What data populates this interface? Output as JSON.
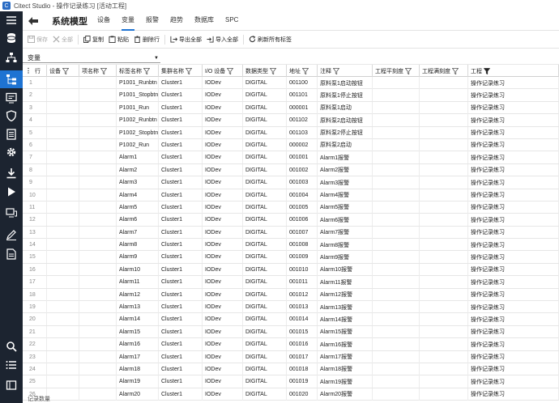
{
  "window": {
    "title": "Citect Studio - 操作记录练习 [活动工程]",
    "logo": "C"
  },
  "sidebar": {
    "items": [
      "database-icon",
      "network-icon",
      "tree-icon",
      "display-icon",
      "shield-icon",
      "document-list-icon",
      "gear-icon",
      "download-icon",
      "play-icon",
      "monitor-icon",
      "edit-icon",
      "report-icon",
      "search-icon",
      "list-icon",
      "book-icon"
    ]
  },
  "nav": {
    "module_title": "系统模型",
    "tabs": [
      "设备",
      "变量",
      "报警",
      "趋势",
      "数据库",
      "SPC"
    ],
    "selected": "变量"
  },
  "toolbar": {
    "save": "保存",
    "delete_all": "全部",
    "copy": "复制",
    "paste": "粘贴",
    "delete_row": "删除行",
    "export_all": "导出全部",
    "import_all": "导入全部",
    "refresh": "刷新所有标签"
  },
  "selector": {
    "value": "变量"
  },
  "grid": {
    "columns": [
      "行",
      "设备",
      "项名称",
      "标签名称",
      "集群名称",
      "I/O 设备",
      "数据类型",
      "地址",
      "注释",
      "工程平刻度",
      "工程满刻度",
      "工程"
    ],
    "rows": [
      [
        "1",
        "",
        "",
        "P1001_Runbtn",
        "Cluster1",
        "IODev",
        "DIGITAL",
        "001100",
        "原料泵1启动按钮",
        "",
        "",
        "操作记录练习"
      ],
      [
        "2",
        "",
        "",
        "P1001_Stopbtn",
        "Cluster1",
        "IODev",
        "DIGITAL",
        "001101",
        "原料泵1停止按钮",
        "",
        "",
        "操作记录练习"
      ],
      [
        "3",
        "",
        "",
        "P1001_Run",
        "Cluster1",
        "IODev",
        "DIGITAL",
        "000001",
        "原料泵1启动",
        "",
        "",
        "操作记录练习"
      ],
      [
        "4",
        "",
        "",
        "P1002_Runbtn",
        "Cluster1",
        "IODev",
        "DIGITAL",
        "001102",
        "原料泵2启动按钮",
        "",
        "",
        "操作记录练习"
      ],
      [
        "5",
        "",
        "",
        "P1002_Stopbtn",
        "Cluster1",
        "IODev",
        "DIGITAL",
        "001103",
        "原料泵2停止按钮",
        "",
        "",
        "操作记录练习"
      ],
      [
        "6",
        "",
        "",
        "P1002_Run",
        "Cluster1",
        "IODev",
        "DIGITAL",
        "000002",
        "原料泵2启动",
        "",
        "",
        "操作记录练习"
      ],
      [
        "7",
        "",
        "",
        "Alarm1",
        "Cluster1",
        "IODev",
        "DIGITAL",
        "001001",
        "Alarm1报警",
        "",
        "",
        "操作记录练习"
      ],
      [
        "8",
        "",
        "",
        "Alarm2",
        "Cluster1",
        "IODev",
        "DIGITAL",
        "001002",
        "Alarm2报警",
        "",
        "",
        "操作记录练习"
      ],
      [
        "9",
        "",
        "",
        "Alarm3",
        "Cluster1",
        "IODev",
        "DIGITAL",
        "001003",
        "Alarm3报警",
        "",
        "",
        "操作记录练习"
      ],
      [
        "10",
        "",
        "",
        "Alarm4",
        "Cluster1",
        "IODev",
        "DIGITAL",
        "001004",
        "Alarm4报警",
        "",
        "",
        "操作记录练习"
      ],
      [
        "11",
        "",
        "",
        "Alarm5",
        "Cluster1",
        "IODev",
        "DIGITAL",
        "001005",
        "Alarm5报警",
        "",
        "",
        "操作记录练习"
      ],
      [
        "12",
        "",
        "",
        "Alarm6",
        "Cluster1",
        "IODev",
        "DIGITAL",
        "001006",
        "Alarm6报警",
        "",
        "",
        "操作记录练习"
      ],
      [
        "13",
        "",
        "",
        "Alarm7",
        "Cluster1",
        "IODev",
        "DIGITAL",
        "001007",
        "Alarm7报警",
        "",
        "",
        "操作记录练习"
      ],
      [
        "14",
        "",
        "",
        "Alarm8",
        "Cluster1",
        "IODev",
        "DIGITAL",
        "001008",
        "Alarm8报警",
        "",
        "",
        "操作记录练习"
      ],
      [
        "15",
        "",
        "",
        "Alarm9",
        "Cluster1",
        "IODev",
        "DIGITAL",
        "001009",
        "Alarm9报警",
        "",
        "",
        "操作记录练习"
      ],
      [
        "16",
        "",
        "",
        "Alarm10",
        "Cluster1",
        "IODev",
        "DIGITAL",
        "001010",
        "Alarm10报警",
        "",
        "",
        "操作记录练习"
      ],
      [
        "17",
        "",
        "",
        "Alarm11",
        "Cluster1",
        "IODev",
        "DIGITAL",
        "001011",
        "Alarm11报警",
        "",
        "",
        "操作记录练习"
      ],
      [
        "18",
        "",
        "",
        "Alarm12",
        "Cluster1",
        "IODev",
        "DIGITAL",
        "001012",
        "Alarm12报警",
        "",
        "",
        "操作记录练习"
      ],
      [
        "19",
        "",
        "",
        "Alarm13",
        "Cluster1",
        "IODev",
        "DIGITAL",
        "001013",
        "Alarm13报警",
        "",
        "",
        "操作记录练习"
      ],
      [
        "20",
        "",
        "",
        "Alarm14",
        "Cluster1",
        "IODev",
        "DIGITAL",
        "001014",
        "Alarm14报警",
        "",
        "",
        "操作记录练习"
      ],
      [
        "21",
        "",
        "",
        "Alarm15",
        "Cluster1",
        "IODev",
        "DIGITAL",
        "001015",
        "Alarm15报警",
        "",
        "",
        "操作记录练习"
      ],
      [
        "22",
        "",
        "",
        "Alarm16",
        "Cluster1",
        "IODev",
        "DIGITAL",
        "001016",
        "Alarm16报警",
        "",
        "",
        "操作记录练习"
      ],
      [
        "23",
        "",
        "",
        "Alarm17",
        "Cluster1",
        "IODev",
        "DIGITAL",
        "001017",
        "Alarm17报警",
        "",
        "",
        "操作记录练习"
      ],
      [
        "24",
        "",
        "",
        "Alarm18",
        "Cluster1",
        "IODev",
        "DIGITAL",
        "001018",
        "Alarm18报警",
        "",
        "",
        "操作记录练习"
      ],
      [
        "25",
        "",
        "",
        "Alarm19",
        "Cluster1",
        "IODev",
        "DIGITAL",
        "001019",
        "Alarm19报警",
        "",
        "",
        "操作记录练习"
      ],
      [
        "26",
        "",
        "",
        "Alarm20",
        "Cluster1",
        "IODev",
        "DIGITAL",
        "001020",
        "Alarm20报警",
        "",
        "",
        "操作记录练习"
      ]
    ]
  },
  "status": {
    "text": "记录数量"
  },
  "colors": {
    "accent": "#1e73d2",
    "sidebar": "#1c2430"
  }
}
